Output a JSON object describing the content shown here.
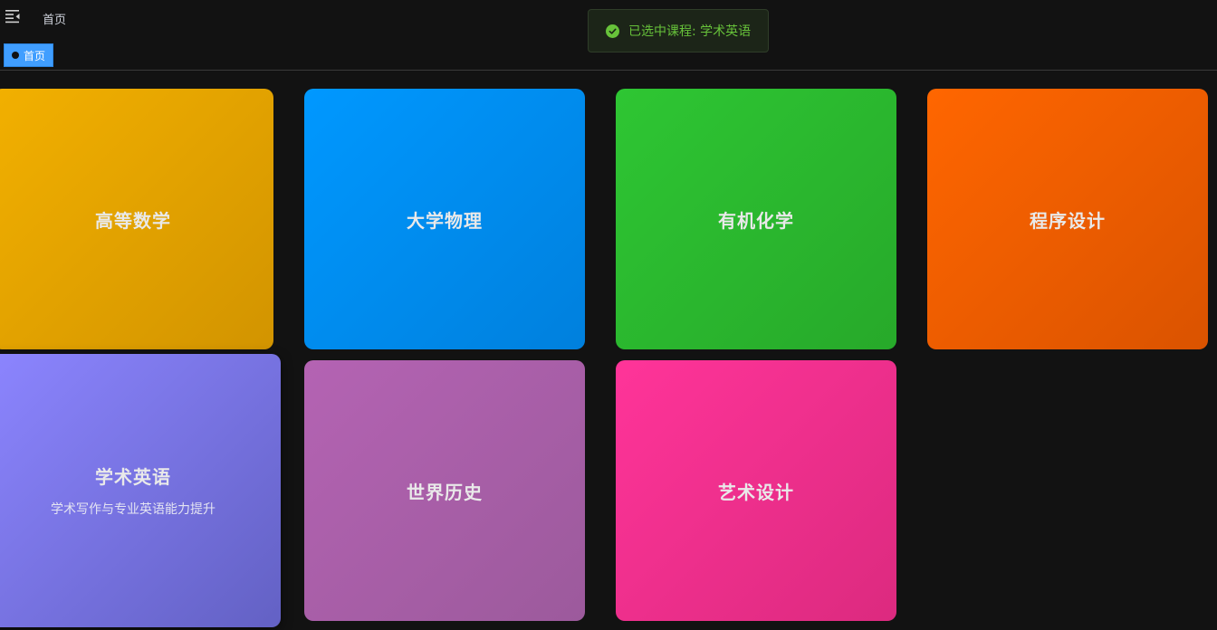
{
  "header": {
    "breadcrumb": "首页",
    "menu_icon": "menu-fold-icon"
  },
  "tags": [
    {
      "label": "首页",
      "active": true
    }
  ],
  "toast": {
    "message": "已选中课程: 学术英语",
    "type": "success",
    "color": "#67c23a",
    "icon": "check-circle-icon"
  },
  "courses": [
    {
      "title": "高等数学",
      "subtitle": "",
      "colors": [
        "#f2b000",
        "#d29400"
      ]
    },
    {
      "title": "大学物理",
      "subtitle": "",
      "colors": [
        "#0098ff",
        "#0080dd"
      ]
    },
    {
      "title": "有机化学",
      "subtitle": "",
      "colors": [
        "#2ec633",
        "#27a92a"
      ]
    },
    {
      "title": "程序设计",
      "subtitle": "",
      "colors": [
        "#ff6600",
        "#da5300"
      ]
    },
    {
      "title": "学术英语",
      "subtitle": "学术写作与专业英语能力提升",
      "colors": [
        "#8c85ff",
        "#6361c4"
      ],
      "selected": true
    },
    {
      "title": "世界历史",
      "subtitle": "",
      "colors": [
        "#b463b3",
        "#9c5a9c"
      ]
    },
    {
      "title": "艺术设计",
      "subtitle": "",
      "colors": [
        "#ff3499",
        "#dc2a7f"
      ]
    }
  ]
}
